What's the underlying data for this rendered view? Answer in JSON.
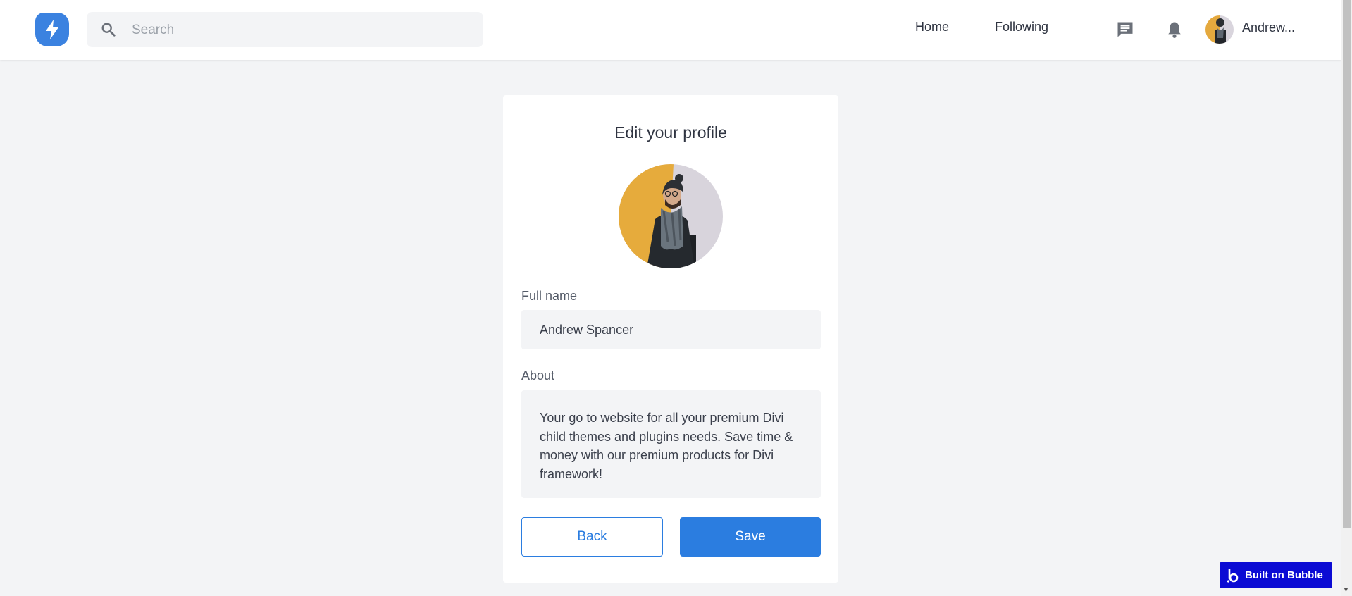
{
  "header": {
    "search_placeholder": "Search",
    "nav": {
      "home": "Home",
      "following": "Following"
    },
    "user_name": "Andrew..."
  },
  "profile_form": {
    "title": "Edit your profile",
    "full_name_label": "Full name",
    "full_name_value": "Andrew Spancer",
    "about_label": "About",
    "about_value": "Your go to website for all your premium Divi child themes and plugins needs. Save time & money with our premium products for Divi framework!",
    "back_label": "Back",
    "save_label": "Save"
  },
  "badge": {
    "label": "Built on Bubble"
  },
  "icons": {
    "logo": "lightning-icon",
    "search": "search-icon",
    "messages": "chat-icon",
    "notifications": "bell-icon"
  },
  "colors": {
    "accent": "#2b7de0",
    "background": "#f3f4f6",
    "badge": "#0b0bd4"
  }
}
